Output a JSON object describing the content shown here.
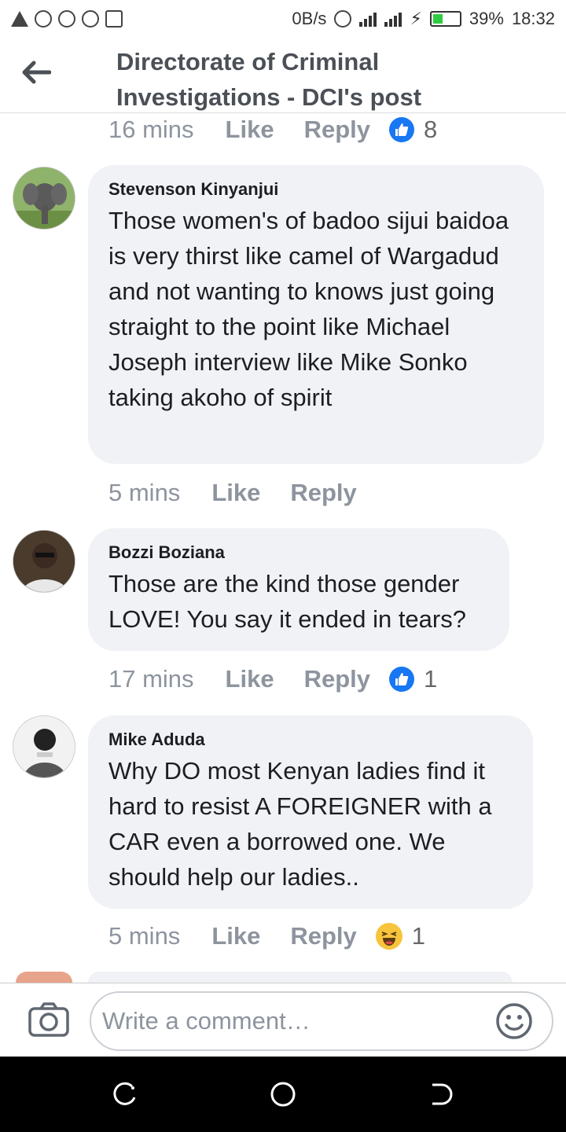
{
  "status_bar": {
    "network_speed": "0B/s",
    "battery_percent": "39%",
    "time": "18:32",
    "battery_level": 0.39
  },
  "header": {
    "title": "Directorate of Criminal Investigations - DCI's post",
    "back_icon": "arrow-left-icon"
  },
  "top_meta": {
    "time": "16 mins",
    "like_label": "Like",
    "reply_label": "Reply",
    "reaction_count": "8"
  },
  "comments": [
    {
      "author": "Stevenson Kinyanjui",
      "text": "Those women's of badoo sijui baidoa is very thirst like camel of Wargadud and not wanting to knows just going straight to the point like Michael Joseph interview like Mike Sonko taking akoho of spirit",
      "time": "5 mins",
      "like_label": "Like",
      "reply_label": "Reply"
    },
    {
      "author": "Bozzi Boziana",
      "text": "Those are the kind those gender LOVE! You say it ended in tears?",
      "time": "17 mins",
      "like_label": "Like",
      "reply_label": "Reply",
      "reaction_count": "1"
    },
    {
      "author": "Mike Aduda",
      "text": "Why DO most Kenyan ladies find it hard to resist A FOREIGNER with a CAR even a borrowed one. We should help our ladies..",
      "time": "5 mins",
      "like_label": "Like",
      "reply_label": "Reply",
      "reaction_count": "1"
    }
  ],
  "compose": {
    "placeholder": "Write a comment…"
  },
  "colors": {
    "accent": "#1877f2",
    "bubble": "#f0f2f5",
    "muted": "#8d949e"
  }
}
